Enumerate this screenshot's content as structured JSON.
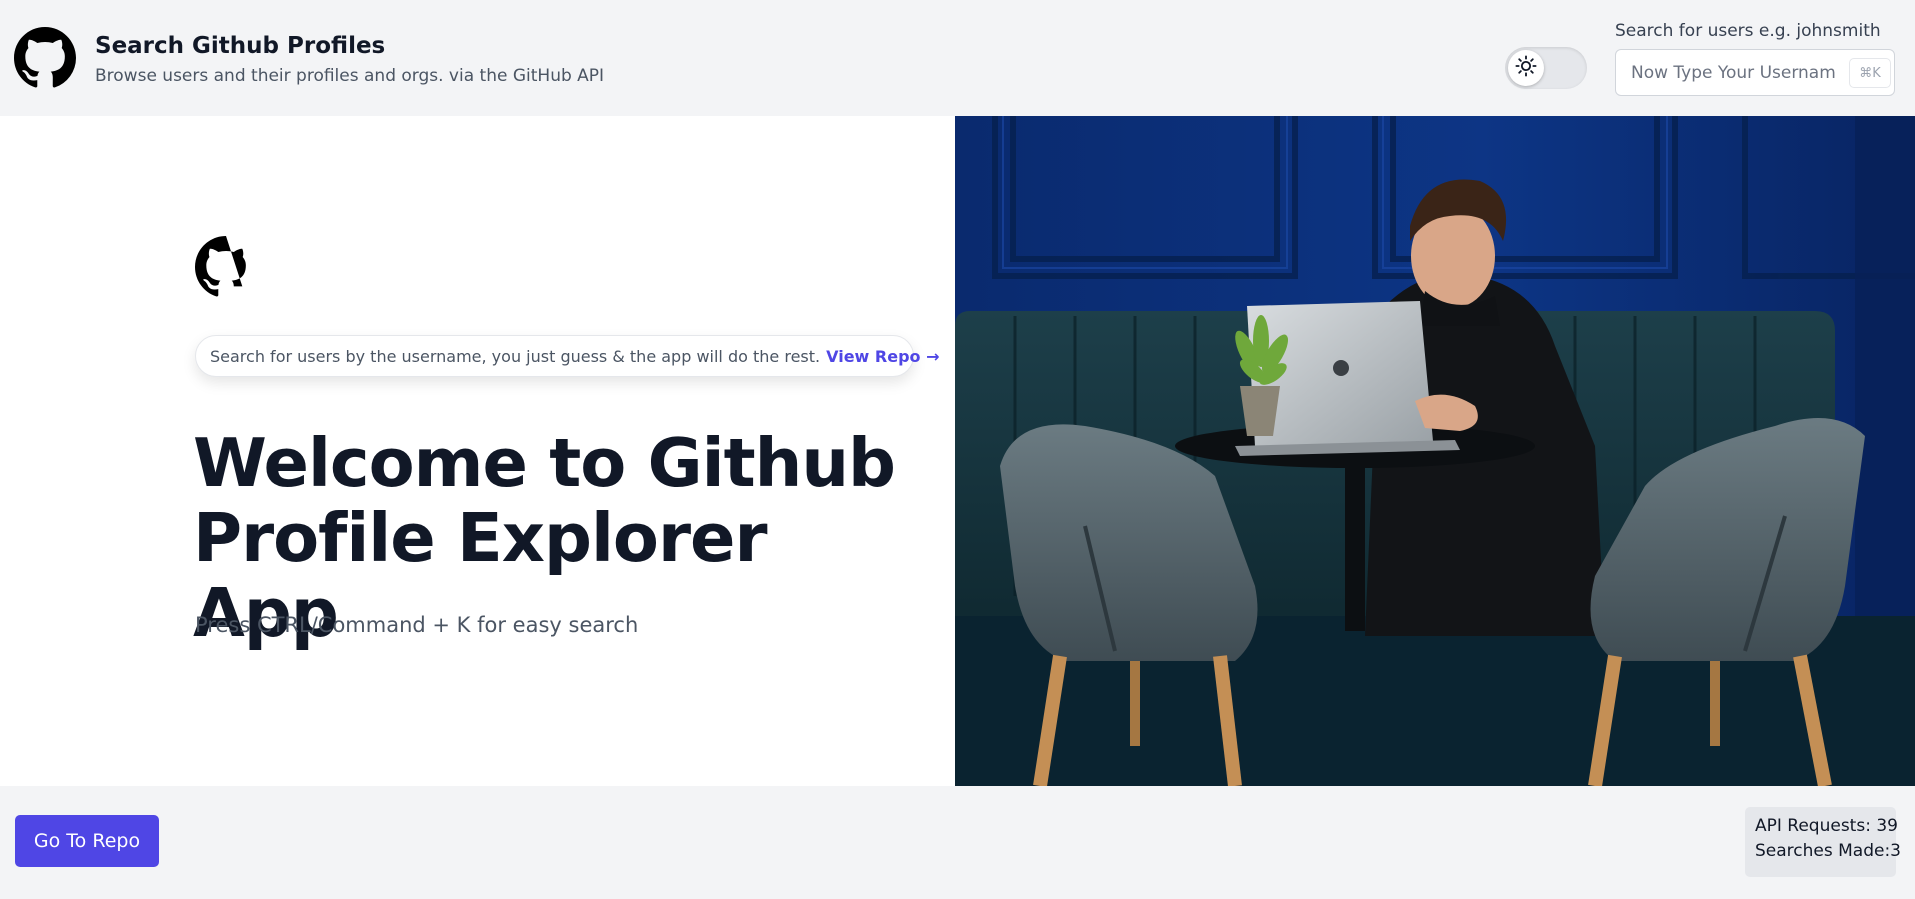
{
  "header": {
    "title": "Search Github Profiles",
    "subtitle": "Browse users and their profiles and orgs. via the GitHub API",
    "logo_icon": "github-octocat-icon",
    "theme_toggle": {
      "icon": "sun-icon",
      "state": "light"
    },
    "search": {
      "label": "Search for users e.g. johnsmith",
      "placeholder": "Now Type Your Username",
      "shortcut": "⌘K"
    }
  },
  "hero": {
    "logo_icon": "github-octocat-icon",
    "announcement": {
      "text": "Search for users by the username, you just guess & the app will do the rest.",
      "link_label": "View Repo →"
    },
    "title_line1": "Welcome to Github",
    "title_line2": "Profile Explorer App",
    "subtitle": "Press CTRL/Command + K for easy search",
    "photo": "man-working-on-laptop-in-blue-cafe-photo"
  },
  "footer": {
    "repo_button": "Go To Repo",
    "api_requests": "API Requests: 39",
    "searches_made": "Searches Made:3"
  },
  "colors": {
    "accent": "#4f46e5",
    "page_bg": "#f3f4f6",
    "hero_bg": "#ffffff",
    "text_dark": "#111827",
    "text_muted": "#4b5563",
    "photo_wall": "#0b2a6b"
  }
}
